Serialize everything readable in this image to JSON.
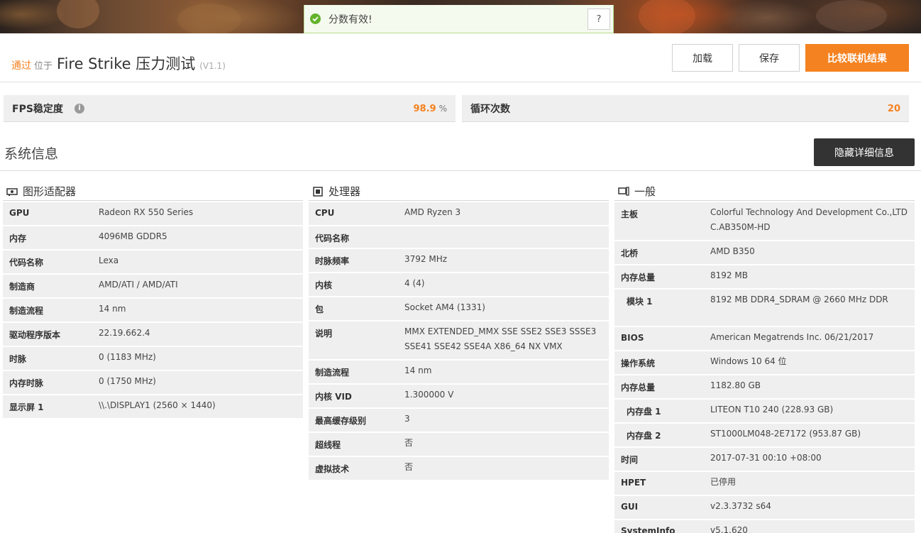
{
  "toast": {
    "message": "分数有效!",
    "help_label": "?"
  },
  "header": {
    "status": "通过",
    "at": "位于",
    "test_name": "Fire Strike 压力测试",
    "version": "(V1.1)",
    "load_label": "加载",
    "save_label": "保存",
    "compare_label": "比较联机结果"
  },
  "stats": {
    "fps_label": "FPS稳定度",
    "fps_value": "98.9",
    "fps_unit": "%",
    "loop_label": "循环次数",
    "loop_value": "20"
  },
  "system": {
    "title": "系统信息",
    "hide_label": "隐藏详细信息"
  },
  "gpu": {
    "title": "图形适配器",
    "rows": [
      {
        "k": "GPU",
        "v": "Radeon RX 550 Series"
      },
      {
        "k": "内存",
        "v": "4096MB GDDR5"
      },
      {
        "k": "代码名称",
        "v": "Lexa"
      },
      {
        "k": "制造商",
        "v": "AMD/ATI / AMD/ATI"
      },
      {
        "k": "制造流程",
        "v": "14 nm"
      },
      {
        "k": "驱动程序版本",
        "v": "22.19.662.4"
      },
      {
        "k": "时脉",
        "v": "0 (1183 MHz)"
      },
      {
        "k": "内存时脉",
        "v": "0 (1750 MHz)"
      },
      {
        "k": "显示屏 1",
        "v": "\\\\.\\DISPLAY1 (2560 × 1440)"
      }
    ]
  },
  "cpu": {
    "title": "处理器",
    "rows": [
      {
        "k": "CPU",
        "v": "AMD Ryzen 3"
      },
      {
        "k": "代码名称",
        "v": ""
      },
      {
        "k": "时脉频率",
        "v": "3792 MHz"
      },
      {
        "k": "内核",
        "v": "4 (4)"
      },
      {
        "k": "包",
        "v": "Socket AM4 (1331)"
      },
      {
        "k": "说明",
        "v": "MMX EXTENDED_MMX SSE SSE2 SSE3 SSSE3 SSE41 SSE42 SSE4A X86_64 NX VMX"
      },
      {
        "k": "制造流程",
        "v": "14 nm"
      },
      {
        "k": "内核 VID",
        "v": "1.300000 V"
      },
      {
        "k": "最高缓存级别",
        "v": "3"
      },
      {
        "k": "超线程",
        "v": "否"
      },
      {
        "k": "虚拟技术",
        "v": "否"
      }
    ]
  },
  "general": {
    "title": "一般",
    "rows": [
      {
        "k": "主板",
        "v": "Colorful Technology And Development Co.,LTD C.AB350M-HD"
      },
      {
        "k": "北桥",
        "v": "AMD B350"
      },
      {
        "k": "内存总量",
        "v": "8192 MB"
      },
      {
        "k": "模块 1",
        "v": "8192 MB DDR4_SDRAM @ 2660 MHz DDR"
      },
      {
        "k": "BIOS",
        "v": "American Megatrends Inc. 06/21/2017"
      },
      {
        "k": "操作系统",
        "v": "Windows 10 64 位"
      },
      {
        "k": "内存总量",
        "v": "1182.80 GB"
      },
      {
        "k": "内存盘 1",
        "v": "LITEON T10 240 (228.93 GB)"
      },
      {
        "k": "内存盘 2",
        "v": "ST1000LM048-2E7172 (953.87 GB)"
      },
      {
        "k": "时间",
        "v": "2017-07-31 00:10 +08:00"
      },
      {
        "k": "HPET",
        "v": "已停用"
      },
      {
        "k": "GUI",
        "v": "v2.3.3732 s64"
      },
      {
        "k": "SystemInfo",
        "v": "v5.1.620"
      }
    ]
  },
  "colors": {
    "accent": "#f58220",
    "dark_button": "#333333",
    "success": "#63b32b"
  }
}
